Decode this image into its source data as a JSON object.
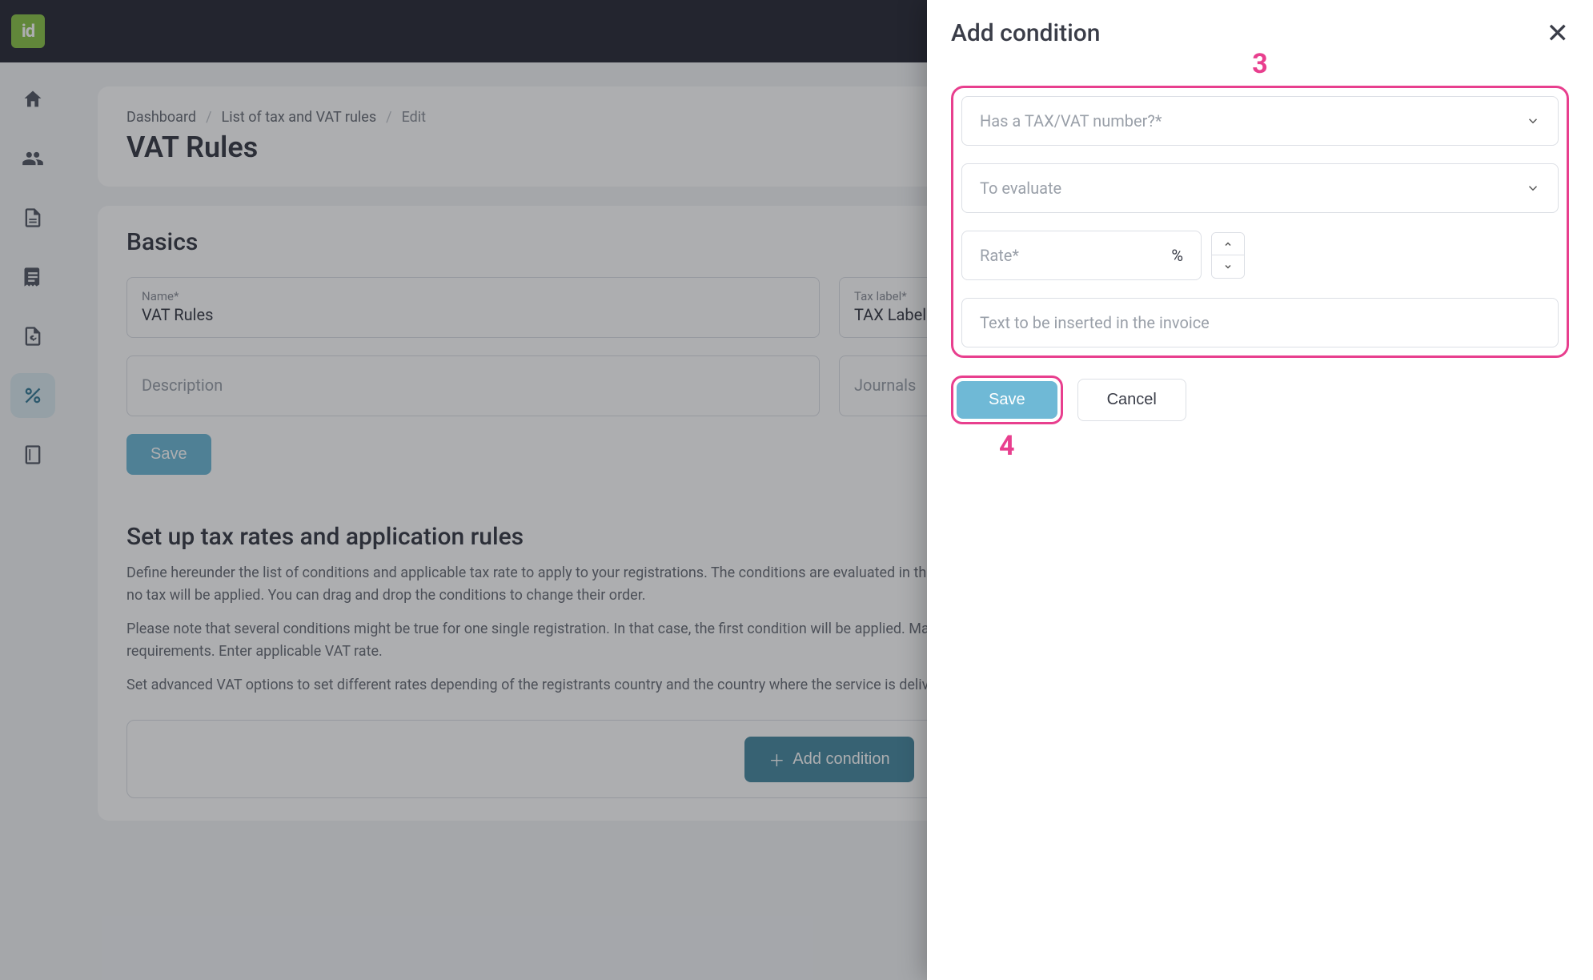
{
  "logo_text": "id",
  "breadcrumb": {
    "items": [
      "Dashboard",
      "List of tax and VAT rules",
      "Edit"
    ]
  },
  "page_title": "VAT Rules",
  "basics": {
    "title": "Basics",
    "name_label": "Name*",
    "name_value": "VAT Rules",
    "tax_label_label": "Tax label*",
    "tax_label_value": "TAX Label",
    "description_placeholder": "Description",
    "journals_placeholder": "Journals",
    "save_label": "Save"
  },
  "rules": {
    "title": "Set up tax rates and application rules",
    "p1": "Define hereunder the list of conditions and applicable tax rate to apply to your registrations. The conditions are evaluated in the order they appear. If a condition is not met, the next one is evaluated. If no condition is met, no tax will be applied. You can drag and drop the conditions to change their order.",
    "p2": "Please note that several conditions might be true for one single registration. In that case, the first condition will be applied. Make sure to order the conditions so the most restrictive one comes first, based on your requirements. Enter applicable VAT rate.",
    "p3": "Set advanced VAT options to set different rates depending of the registrants country and the country where the service is delivered.",
    "add_condition_label": "Add condition"
  },
  "panel": {
    "title": "Add condition",
    "field_condition_placeholder": "Has a TAX/VAT number?*",
    "field_evaluate_placeholder": "To evaluate",
    "rate_placeholder": "Rate*",
    "rate_suffix": "%",
    "invoice_text_placeholder": "Text to be inserted in the invoice",
    "save_label": "Save",
    "cancel_label": "Cancel",
    "callout3": "3",
    "callout4": "4"
  }
}
